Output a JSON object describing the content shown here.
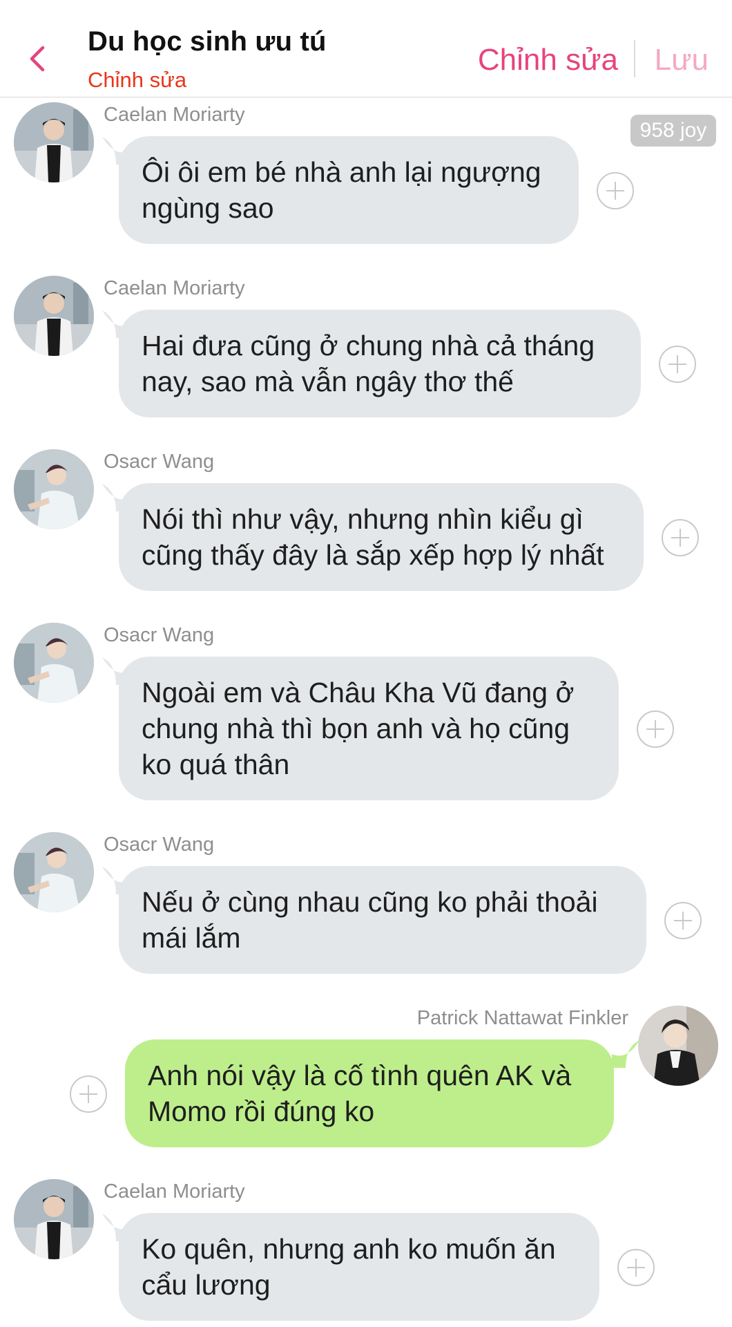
{
  "header": {
    "title": "Du học sinh ưu tú",
    "subtitle": "Chỉnh sửa",
    "edit_label": "Chỉnh sửa",
    "save_label": "Lưu"
  },
  "joy_badge": "958 joy",
  "colors": {
    "accent_pink": "#e6447e",
    "save_pink_light": "#f4a9c3",
    "subtitle_red": "#e8361b",
    "incoming_bubble": "#e4e7ea",
    "outgoing_bubble": "#bdee8b"
  },
  "messages": [
    {
      "sender": "Caelan Moriarty",
      "side": "incoming",
      "avatar": "caelan-avatar",
      "lines": [
        "Ôi ôi em bé nhà anh lại ngượng",
        "ngùng sao"
      ]
    },
    {
      "sender": "Caelan Moriarty",
      "side": "incoming",
      "avatar": "caelan-avatar",
      "lines": [
        "Hai đưa cũng ở chung nhà cả tháng",
        "nay, sao mà vẫn ngây thơ thế"
      ]
    },
    {
      "sender": "Osacr Wang",
      "side": "incoming",
      "avatar": "oscar-avatar",
      "lines": [
        "Nói thì như vậy, nhưng nhìn kiểu gì",
        "cũng thấy đây là sắp xếp hợp lý nhất"
      ]
    },
    {
      "sender": "Osacr Wang",
      "side": "incoming",
      "avatar": "oscar-avatar",
      "lines": [
        "Ngoài em và Châu Kha Vũ đang ở",
        "chung nhà thì bọn anh và họ cũng",
        "ko quá thân"
      ]
    },
    {
      "sender": "Osacr Wang",
      "side": "incoming",
      "avatar": "oscar-avatar",
      "lines": [
        "Nếu ở cùng nhau cũng ko phải thoải",
        "mái lắm"
      ]
    },
    {
      "sender": "Patrick Nattawat Finkler",
      "side": "outgoing",
      "avatar": "patrick-avatar",
      "lines": [
        "Anh nói vậy là cố tình quên AK và",
        "Momo rồi đúng ko"
      ]
    },
    {
      "sender": "Caelan Moriarty",
      "side": "incoming",
      "avatar": "caelan-avatar",
      "lines": [
        "Ko quên, nhưng anh ko muốn ăn",
        "cẩu lương"
      ]
    }
  ]
}
